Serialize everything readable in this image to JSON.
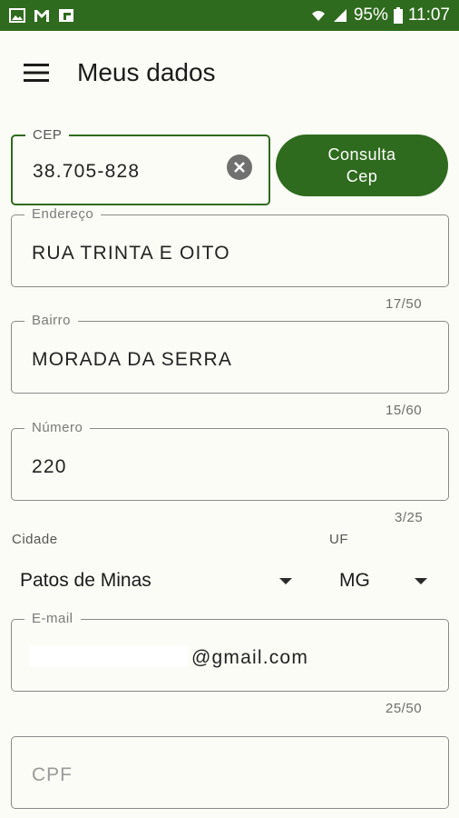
{
  "statusbar": {
    "battery": "95%",
    "time": "11:07"
  },
  "header": {
    "title": "Meus dados"
  },
  "cep": {
    "label": "CEP",
    "value": "38.705-828"
  },
  "consulta_button": {
    "label_line1": "Consulta",
    "label_line2": "Cep"
  },
  "endereco": {
    "label": "Endereço",
    "value": "RUA TRINTA E OITO",
    "counter": "17/50"
  },
  "bairro": {
    "label": "Bairro",
    "value": "MORADA DA SERRA",
    "counter": "15/60"
  },
  "numero": {
    "label": "Número",
    "value": "220",
    "counter": "3/25"
  },
  "cidade": {
    "label": "Cidade",
    "value": "Patos de Minas"
  },
  "uf": {
    "label": "UF",
    "value": "MG"
  },
  "email": {
    "label": "E-mail",
    "value": "@gmail.com",
    "counter": "25/50"
  },
  "cpf": {
    "placeholder": "CPF"
  },
  "colors": {
    "primary": "#2f6b1e",
    "background": "#fbfcf5",
    "border": "#8a8a8a"
  }
}
